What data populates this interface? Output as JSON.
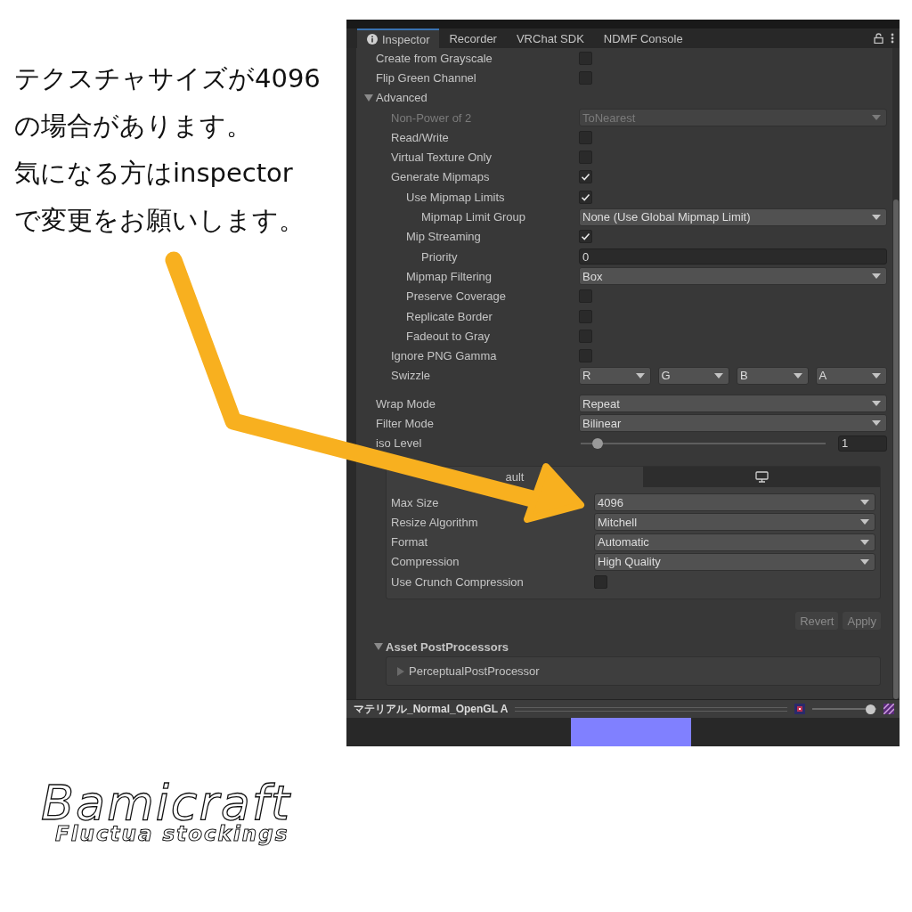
{
  "annotation": {
    "lines": [
      "テクスチャサイズが4096",
      "の場合があります。",
      "気になる方はinspector",
      "で変更をお願いします。"
    ]
  },
  "inspector": {
    "tabs": [
      {
        "label": "Inspector",
        "selected": true,
        "kind": "info"
      },
      {
        "label": "Recorder",
        "selected": false,
        "kind": "text"
      },
      {
        "label": "VRChat SDK",
        "selected": false,
        "kind": "text"
      },
      {
        "label": "NDMF Console",
        "selected": false,
        "kind": "text"
      }
    ],
    "rows": [
      {
        "kind": "checkbox",
        "label": "Create from Grayscale",
        "checked": false
      },
      {
        "kind": "checkbox",
        "label": "Flip Green Channel",
        "checked": false
      },
      {
        "kind": "foldout",
        "label": "Advanced",
        "expanded": true,
        "children": [
          {
            "kind": "dropdown",
            "label": "Non-Power of 2",
            "value": "ToNearest",
            "disabled": true
          },
          {
            "kind": "checkbox",
            "label": "Read/Write",
            "checked": false
          },
          {
            "kind": "checkbox",
            "label": "Virtual Texture Only",
            "checked": false
          },
          {
            "kind": "checkbox",
            "label": "Generate Mipmaps",
            "checked": true,
            "children": [
              {
                "kind": "checkbox",
                "label": "Use Mipmap Limits",
                "checked": true,
                "children": [
                  {
                    "kind": "dropdown",
                    "label": "Mipmap Limit Group",
                    "value": "None (Use Global Mipmap Limit)",
                    "disabled": false
                  }
                ]
              },
              {
                "kind": "checkbox",
                "label": "Mip Streaming",
                "checked": true,
                "children": [
                  {
                    "kind": "field",
                    "label": "Priority",
                    "value": "0"
                  }
                ]
              },
              {
                "kind": "dropdown",
                "label": "Mipmap Filtering",
                "value": "Box",
                "disabled": false
              },
              {
                "kind": "checkbox",
                "label": "Preserve Coverage",
                "checked": false
              },
              {
                "kind": "checkbox",
                "label": "Replicate Border",
                "checked": false
              },
              {
                "kind": "checkbox",
                "label": "Fadeout to Gray",
                "checked": false
              }
            ]
          },
          {
            "kind": "checkbox",
            "label": "Ignore PNG Gamma",
            "checked": false
          },
          {
            "kind": "swizzle",
            "label": "Swizzle",
            "values": [
              "R",
              "G",
              "B",
              "A"
            ]
          }
        ]
      },
      {
        "kind": "dropdown",
        "label": "Wrap Mode",
        "value": "Repeat",
        "disabled": false
      },
      {
        "kind": "dropdown",
        "label": "Filter Mode",
        "value": "Bilinear",
        "disabled": false
      },
      {
        "kind": "slider",
        "label": "iso Level",
        "level": 0.05,
        "reading": "1"
      }
    ],
    "platform": {
      "tabs": [
        {
          "kind": "text",
          "label": "ault",
          "selected": true
        },
        {
          "kind": "monitor",
          "selected": false
        }
      ],
      "rows": [
        {
          "kind": "dropdown",
          "label": "Max Size",
          "value": "4096",
          "disabled": false
        },
        {
          "kind": "dropdown",
          "label": "Resize Algorithm",
          "value": "Mitchell",
          "disabled": false
        },
        {
          "kind": "dropdown",
          "label": "Format",
          "value": "Automatic",
          "disabled": false
        },
        {
          "kind": "dropdown",
          "label": "Compression",
          "value": "High Quality",
          "disabled": false
        },
        {
          "kind": "checkbox",
          "label": "Use Crunch Compression",
          "checked": false
        }
      ]
    },
    "buttons": [
      "Revert",
      "Apply"
    ],
    "post_processors": {
      "title": "Asset PostProcessors",
      "expanded": true,
      "items": [
        {
          "label": "PerceptualPostProcessor",
          "expanded": false
        }
      ]
    },
    "preview": {
      "title": "マテリアル_Normal_OpenGL A",
      "level": 1
    }
  },
  "logo": {
    "title": "Bamicraft",
    "subtitle": "Fluctua stockings"
  }
}
